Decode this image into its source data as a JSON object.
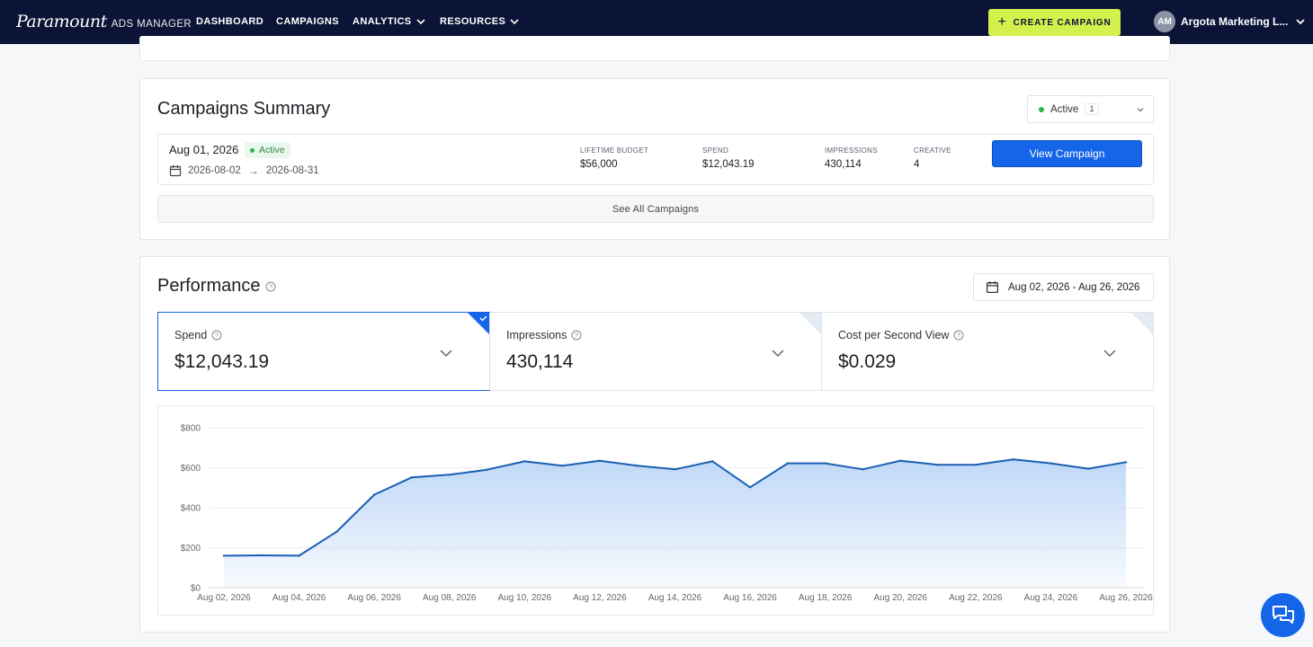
{
  "nav": {
    "brand": "Paramount",
    "brand_sub": "ADS MANAGER",
    "links": [
      "DASHBOARD",
      "CAMPAIGNS",
      "ANALYTICS",
      "RESOURCES"
    ],
    "create_label": "CREATE CAMPAIGN",
    "avatar_initials": "AM",
    "account_name": "Argota Marketing L...",
    "accent": "#d3f04c",
    "bg": "#0b1436"
  },
  "summary": {
    "title": "Campaigns Summary",
    "status_filter": {
      "label": "Active",
      "count": "1"
    },
    "campaign": {
      "date": "Aug 01, 2026",
      "status": "Active",
      "start": "2026-08-02",
      "end": "2026-08-31",
      "budget_label": "LIFETIME BUDGET",
      "budget": "$56,000",
      "spend_label": "SPEND",
      "spend": "$12,043.19",
      "impressions_label": "IMPRESSIONS",
      "impressions": "430,114",
      "creative_label": "CREATIVE",
      "creative": "4",
      "view_label": "View Campaign"
    },
    "see_all": "See All Campaigns"
  },
  "performance": {
    "title": "Performance",
    "date_range": "Aug 02, 2026 - Aug 26, 2026",
    "metrics": [
      {
        "label": "Spend",
        "value": "$12,043.19",
        "selected": true
      },
      {
        "label": "Impressions",
        "value": "430,114",
        "selected": false
      },
      {
        "label": "Cost per Second View",
        "value": "$0.029",
        "selected": false
      }
    ]
  },
  "chart_data": {
    "type": "area",
    "y_ticks": [
      "$800",
      "$600",
      "$400",
      "$200",
      "$0"
    ],
    "ylim": [
      0,
      800
    ],
    "x_tick_labels": [
      "Aug 02, 2026",
      "Aug 04, 2026",
      "Aug 06, 2026",
      "Aug 08, 2026",
      "Aug 10, 2026",
      "Aug 12, 2026",
      "Aug 14, 2026",
      "Aug 16, 2026",
      "Aug 18, 2026",
      "Aug 20, 2026",
      "Aug 22, 2026",
      "Aug 24, 2026",
      "Aug 26, 2026"
    ],
    "x": [
      "Aug 02, 2026",
      "Aug 03, 2026",
      "Aug 04, 2026",
      "Aug 05, 2026",
      "Aug 06, 2026",
      "Aug 07, 2026",
      "Aug 08, 2026",
      "Aug 09, 2026",
      "Aug 10, 2026",
      "Aug 11, 2026",
      "Aug 12, 2026",
      "Aug 13, 2026",
      "Aug 14, 2026",
      "Aug 15, 2026",
      "Aug 16, 2026",
      "Aug 17, 2026",
      "Aug 18, 2026",
      "Aug 19, 2026",
      "Aug 20, 2026",
      "Aug 21, 2026",
      "Aug 22, 2026",
      "Aug 23, 2026",
      "Aug 24, 2026",
      "Aug 25, 2026",
      "Aug 26, 2026"
    ],
    "values": [
      160,
      162,
      160,
      280,
      465,
      552,
      565,
      590,
      632,
      610,
      635,
      610,
      592,
      632,
      502,
      622,
      622,
      592,
      635,
      615,
      615,
      642,
      622,
      595,
      628
    ],
    "color": "#1a5fb4",
    "fill": "#bcd6f7",
    "grid": true
  }
}
